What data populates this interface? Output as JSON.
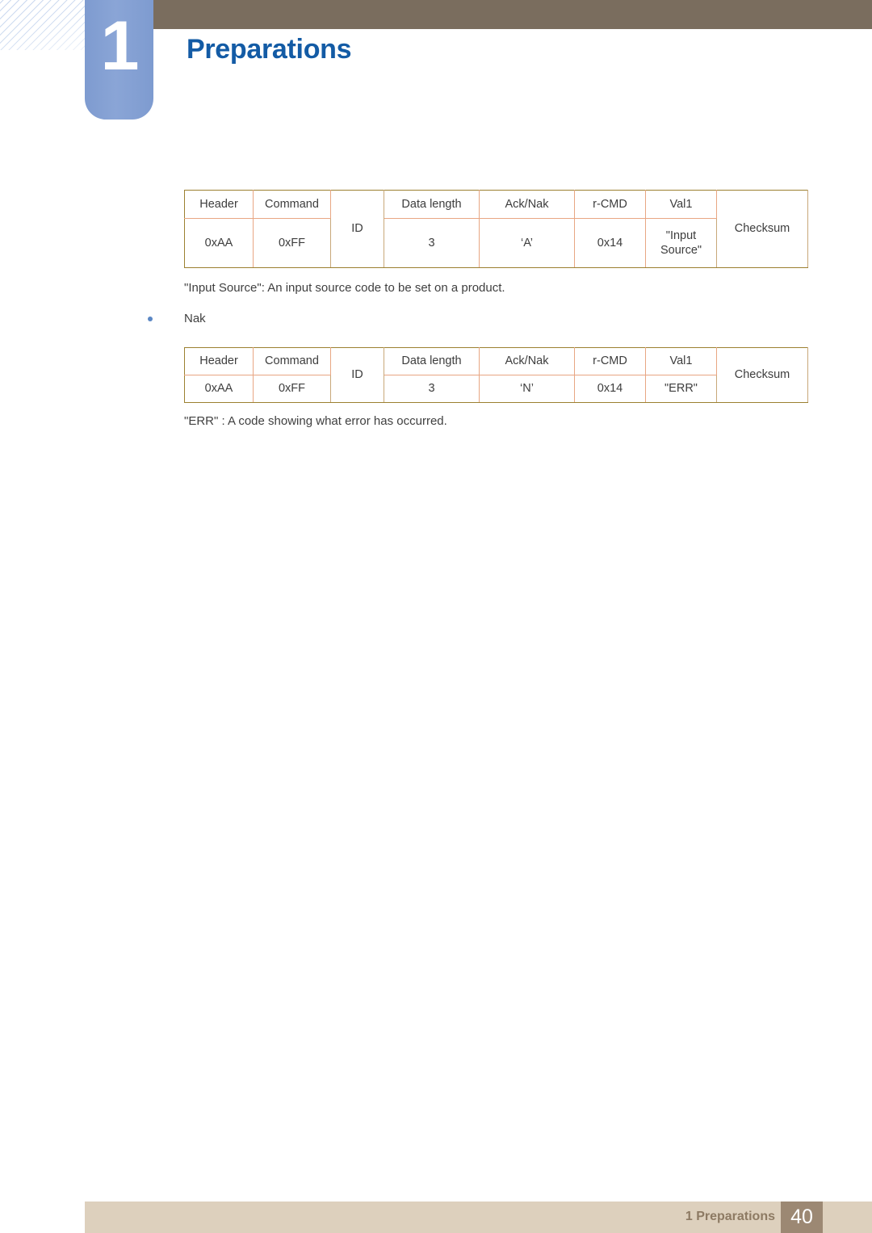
{
  "header": {
    "chapter_number": "1",
    "chapter_title": "Preparations",
    "bar_color": "#7a6d5e",
    "badge_color": "#8aa5d6",
    "title_color": "#135ba5"
  },
  "tables": {
    "ack": {
      "headers": [
        "Header",
        "Command",
        "ID",
        "Data length",
        "Ack/Nak",
        "r-CMD",
        "Val1",
        "Checksum"
      ],
      "values": {
        "header": "0xAA",
        "command": "0xFF",
        "id": "ID",
        "data_length": "3",
        "ack_nak": "‘A’",
        "r_cmd": "0x14",
        "val1": "\"Input Source\"",
        "checksum": "Checksum"
      }
    },
    "nak": {
      "headers": [
        "Header",
        "Command",
        "ID",
        "Data length",
        "Ack/Nak",
        "r-CMD",
        "Val1",
        "Checksum"
      ],
      "values": {
        "header": "0xAA",
        "command": "0xFF",
        "id": "ID",
        "data_length": "3",
        "ack_nak": "‘N’",
        "r_cmd": "0x14",
        "val1": "\"ERR\"",
        "checksum": "Checksum"
      }
    }
  },
  "notes": {
    "input_source": "\"Input Source\": An input source code to be set on a product.",
    "err": "\"ERR\" : A code showing what error has occurred."
  },
  "bullets": {
    "nak": "Nak"
  },
  "footer": {
    "label": "1 Preparations",
    "page_number": "40",
    "bar_color": "#ddd0bd",
    "badge_color": "#9c8873"
  }
}
